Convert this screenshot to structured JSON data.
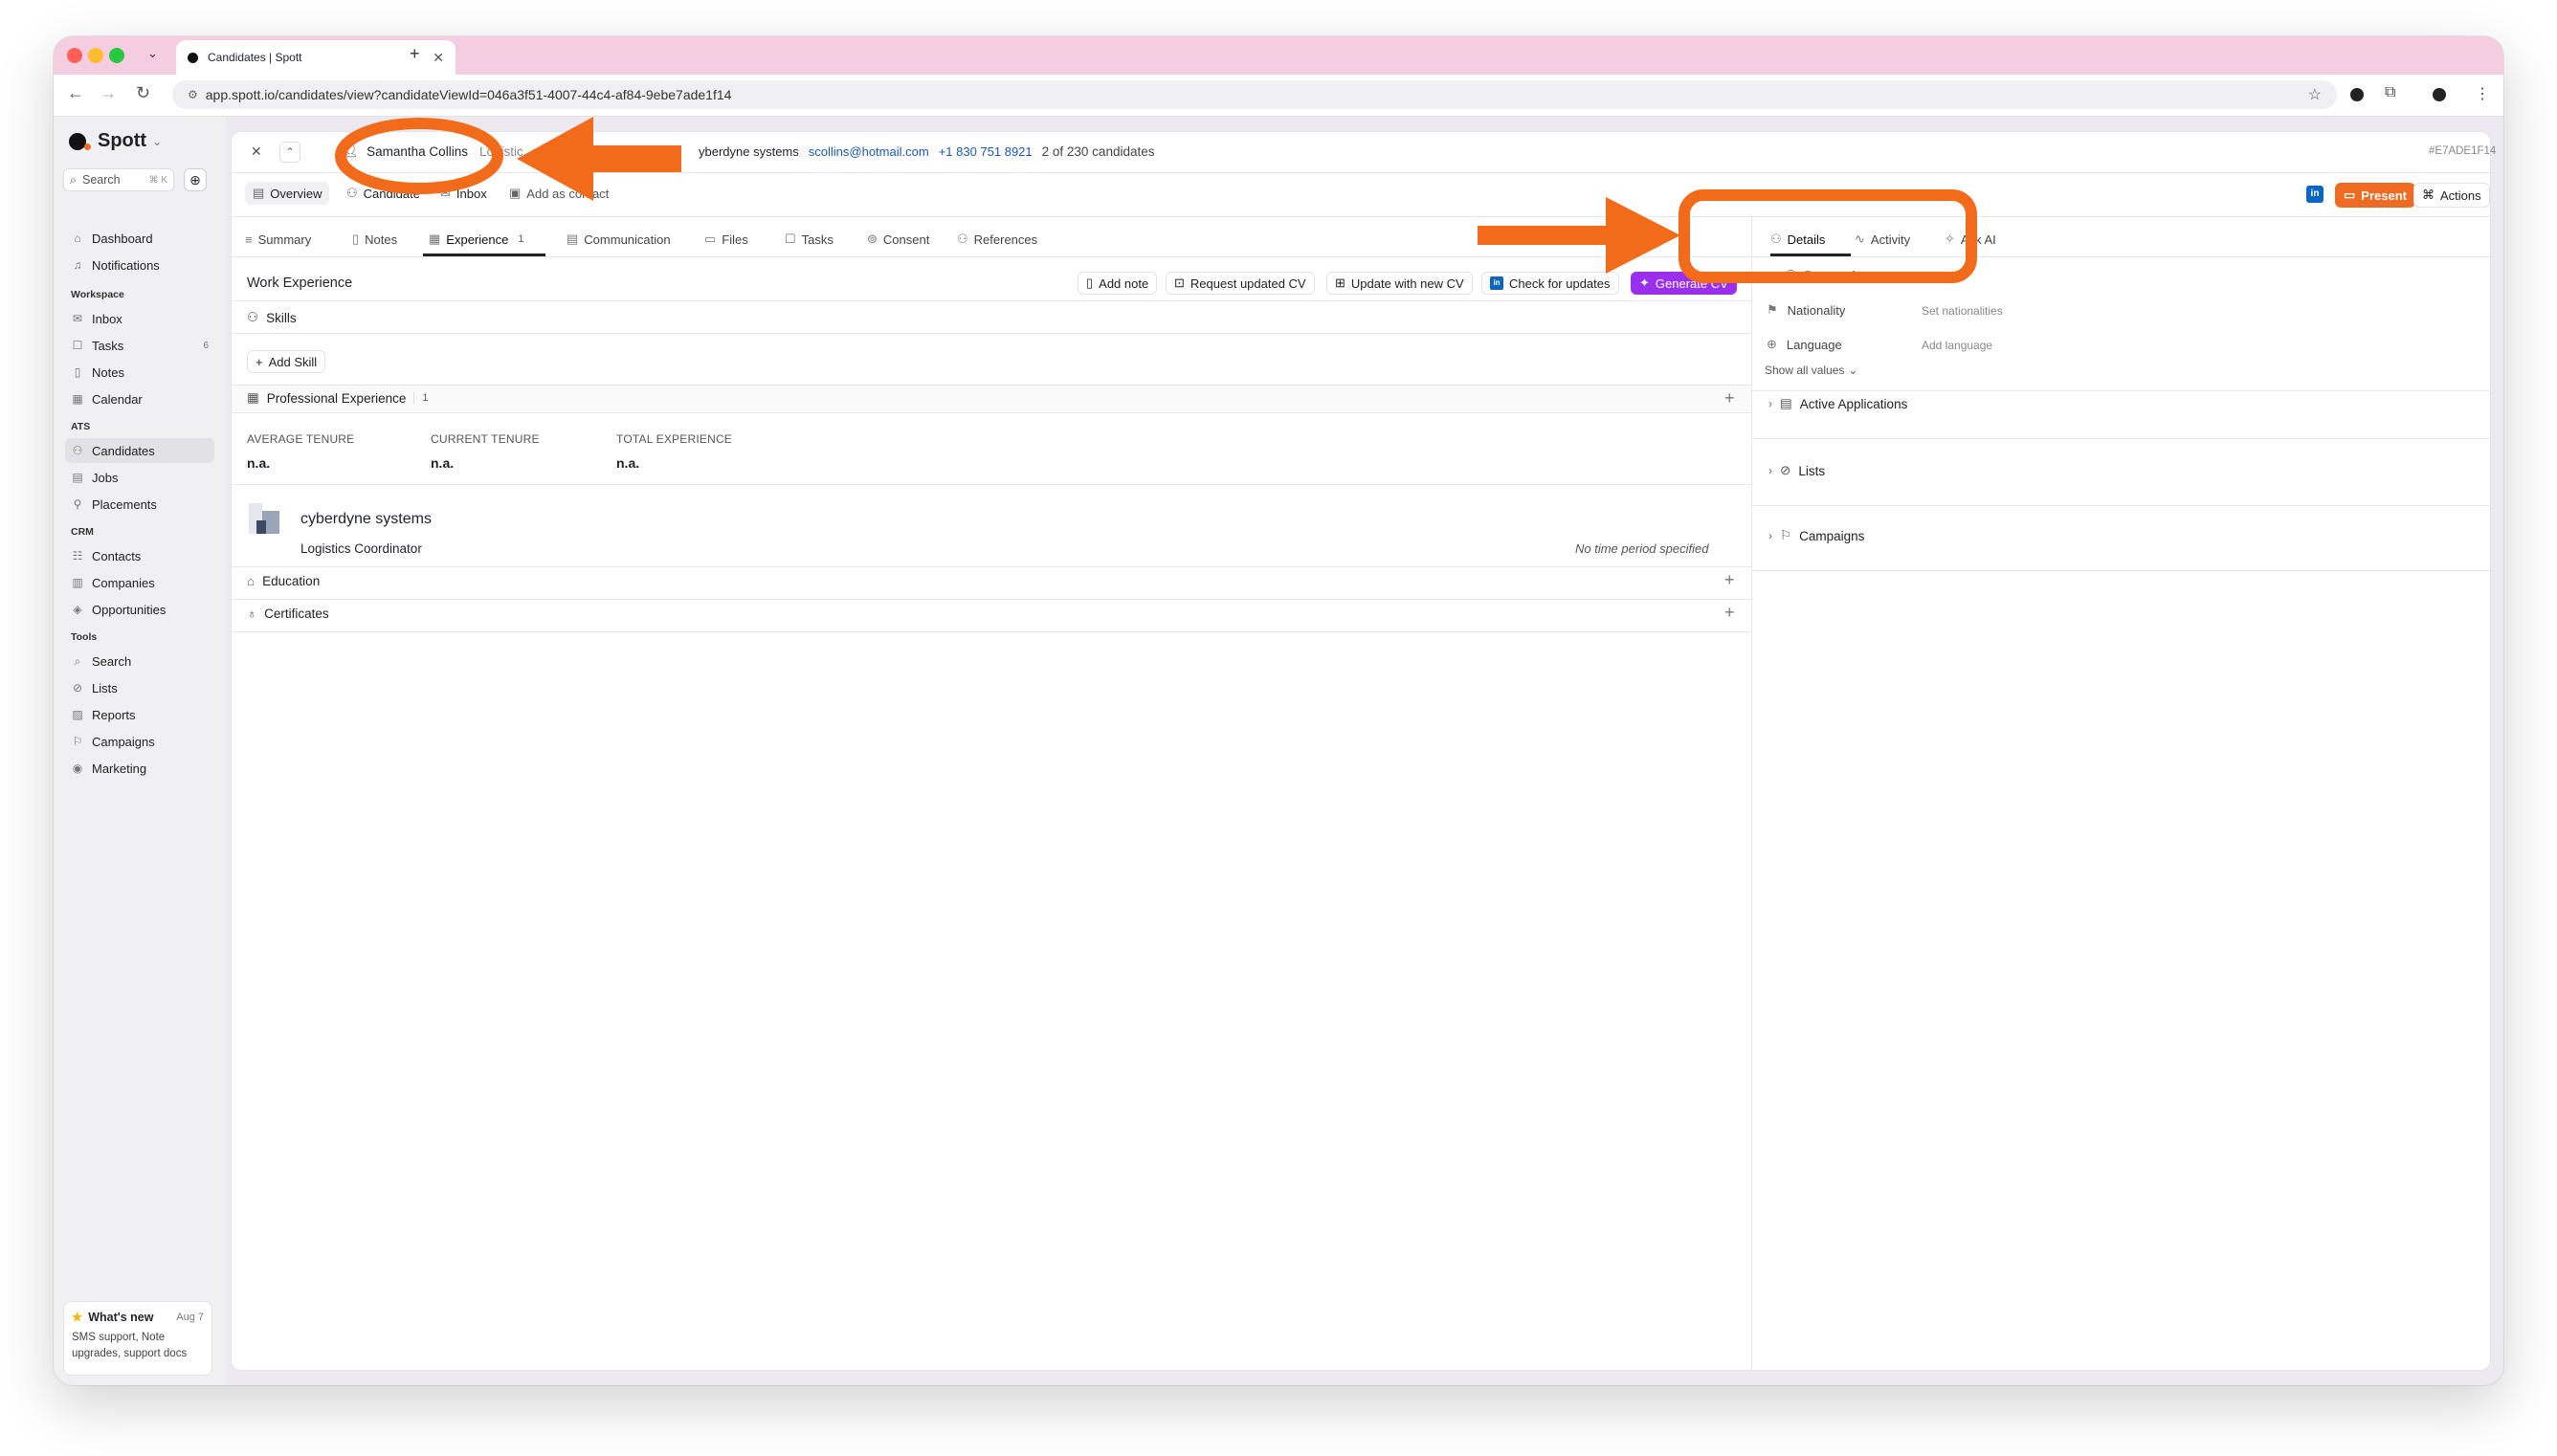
{
  "browser": {
    "tab_title": "Candidates | Spott",
    "url": "app.spott.io/candidates/view?candidateViewId=046a3f51-4007-44c4-af84-9ebe7ade1f14"
  },
  "sidebar": {
    "brand": "Spott",
    "search_label": "Search",
    "search_shortcut": "⌘ K",
    "top_items": [
      {
        "label": "Dashboard",
        "icon": "home-icon"
      },
      {
        "label": "Notifications",
        "icon": "bell-icon"
      }
    ],
    "sections": [
      {
        "title": "Workspace",
        "items": [
          {
            "label": "Inbox"
          },
          {
            "label": "Tasks",
            "badge": "6"
          },
          {
            "label": "Notes"
          },
          {
            "label": "Calendar"
          }
        ]
      },
      {
        "title": "ATS",
        "items": [
          {
            "label": "Candidates"
          },
          {
            "label": "Jobs"
          },
          {
            "label": "Placements"
          }
        ]
      },
      {
        "title": "CRM",
        "items": [
          {
            "label": "Contacts"
          },
          {
            "label": "Companies"
          },
          {
            "label": "Opportunities"
          }
        ]
      },
      {
        "title": "Tools",
        "items": [
          {
            "label": "Search"
          },
          {
            "label": "Lists"
          },
          {
            "label": "Reports"
          },
          {
            "label": "Campaigns"
          },
          {
            "label": "Marketing"
          }
        ]
      }
    ],
    "whats_new": {
      "title": "What's new",
      "date": "Aug 7",
      "body": "SMS support, Note upgrades, support docs"
    }
  },
  "header": {
    "candidate_name": "Samantha Collins",
    "role_fragment": "Logistic",
    "company_fragment": "yberdyne systems",
    "email": "scollins@hotmail.com",
    "phone": "+1 830 751 8921",
    "position": "2 of 230 candidates",
    "record_id": "#E7ADE1F14"
  },
  "subnav": {
    "overview": "Overview",
    "candidate": "Candidate",
    "inbox": "Inbox",
    "add_contact": "Add as contact",
    "present": "Present",
    "actions": "Actions"
  },
  "tabs": [
    {
      "label": "Summary"
    },
    {
      "label": "Notes"
    },
    {
      "label": "Experience",
      "count": "1"
    },
    {
      "label": "Communication"
    },
    {
      "label": "Files"
    },
    {
      "label": "Tasks"
    },
    {
      "label": "Consent"
    },
    {
      "label": "References"
    }
  ],
  "experience": {
    "title": "Work Experience",
    "actions": {
      "add_note": "Add note",
      "request_cv": "Request updated CV",
      "update_cv": "Update with new CV",
      "check_updates": "Check for updates",
      "generate_cv": "Generate CV"
    },
    "skills": "Skills",
    "add_skill": "Add Skill",
    "professional": "Professional Experience",
    "professional_count": "1",
    "stats": [
      {
        "label": "AVERAGE TENURE",
        "value": "n.a."
      },
      {
        "label": "CURRENT TENURE",
        "value": "n.a."
      },
      {
        "label": "TOTAL EXPERIENCE",
        "value": "n.a."
      }
    ],
    "job": {
      "company": "cyberdyne systems",
      "title": "Logistics Coordinator",
      "period": "No time period specified"
    },
    "education": "Education",
    "certificates": "Certificates"
  },
  "right_panel": {
    "tabs": [
      {
        "label": "Details"
      },
      {
        "label": "Activity"
      },
      {
        "label": "Ask AI"
      }
    ],
    "personal": "Personal",
    "nationality_label": "Nationality",
    "nationality_value": "Set nationalities",
    "language_label": "Language",
    "language_value": "Add language",
    "show_all": "Show all values",
    "sections": [
      {
        "label": "Active Applications"
      },
      {
        "label": "Lists"
      },
      {
        "label": "Campaigns"
      }
    ]
  },
  "colors": {
    "accent": "#f06b22",
    "ai": "#9b2ff0",
    "link": "#1a56c8",
    "annotation": "#f26b1b"
  }
}
